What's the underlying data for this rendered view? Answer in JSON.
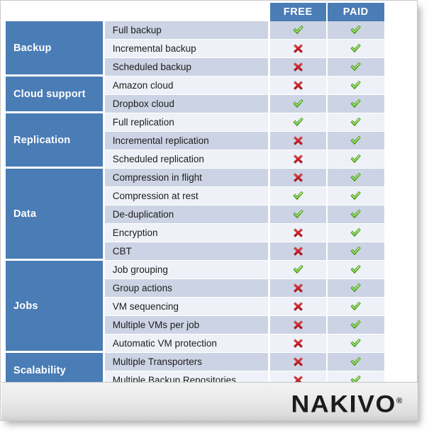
{
  "header": {
    "columns": [
      "FREE",
      "PAID"
    ]
  },
  "colors": {
    "brand_blue": "#4a7cb5",
    "row_dark": "#ccd3e4",
    "row_light": "#eef1f7",
    "check_green": "#5cbf1a",
    "cross_red": "#cc2027",
    "logo_black": "#1b1b1b"
  },
  "icons": {
    "check": "check-icon",
    "cross": "cross-icon"
  },
  "categories": [
    {
      "name": "Backup",
      "rows": [
        {
          "feature": "Full backup",
          "free": "check",
          "paid": "check"
        },
        {
          "feature": "Incremental backup",
          "free": "cross",
          "paid": "check"
        },
        {
          "feature": "Scheduled backup",
          "free": "cross",
          "paid": "check"
        }
      ]
    },
    {
      "name": "Cloud support",
      "rows": [
        {
          "feature": "Amazon cloud",
          "free": "cross",
          "paid": "check"
        },
        {
          "feature": "Dropbox cloud",
          "free": "check",
          "paid": "check"
        }
      ]
    },
    {
      "name": "Replication",
      "rows": [
        {
          "feature": "Full replication",
          "free": "check",
          "paid": "check"
        },
        {
          "feature": "Incremental replication",
          "free": "cross",
          "paid": "check"
        },
        {
          "feature": "Scheduled replication",
          "free": "cross",
          "paid": "check"
        }
      ]
    },
    {
      "name": "Data",
      "rows": [
        {
          "feature": "Compression in flight",
          "free": "cross",
          "paid": "check"
        },
        {
          "feature": "Compression at rest",
          "free": "check",
          "paid": "check"
        },
        {
          "feature": "De-duplication",
          "free": "check",
          "paid": "check"
        },
        {
          "feature": "Encryption",
          "free": "cross",
          "paid": "check"
        },
        {
          "feature": "CBT",
          "free": "cross",
          "paid": "check"
        }
      ]
    },
    {
      "name": "Jobs",
      "rows": [
        {
          "feature": "Job grouping",
          "free": "check",
          "paid": "check"
        },
        {
          "feature": "Group actions",
          "free": "cross",
          "paid": "check"
        },
        {
          "feature": "VM sequencing",
          "free": "cross",
          "paid": "check"
        },
        {
          "feature": "Multiple VMs per job",
          "free": "cross",
          "paid": "check"
        },
        {
          "feature": "Automatic VM protection",
          "free": "cross",
          "paid": "check"
        }
      ]
    },
    {
      "name": "Scalability",
      "rows": [
        {
          "feature": "Multiple Transporters",
          "free": "cross",
          "paid": "check"
        },
        {
          "feature": "Multiple Backup Repositories",
          "free": "cross",
          "paid": "check"
        }
      ]
    }
  ],
  "footer": {
    "logo_text": "NAKIVO",
    "logo_mark": "®"
  }
}
